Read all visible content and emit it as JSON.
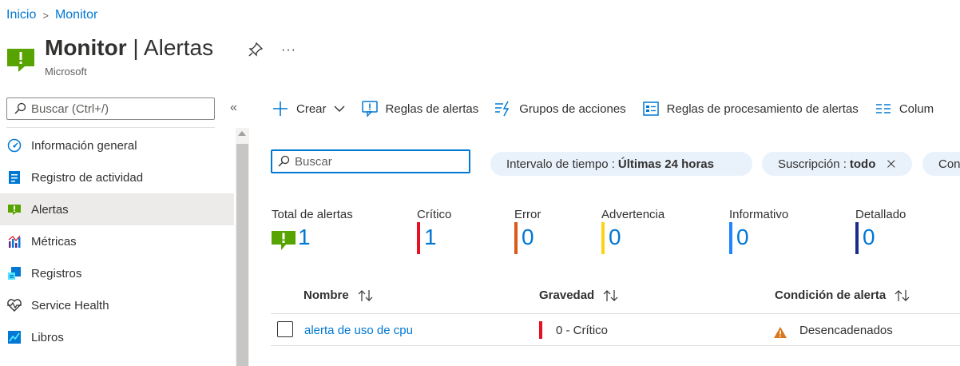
{
  "breadcrumb": {
    "home": "Inicio",
    "current": "Monitor"
  },
  "header": {
    "title_bold": "Monitor",
    "title_rest": " | Alertas",
    "subtitle": "Microsoft",
    "more": "···"
  },
  "sidebar": {
    "search_placeholder": "Buscar (Ctrl+/)",
    "collapse": "«",
    "items": [
      {
        "label": "Información general",
        "icon": "gauge-icon"
      },
      {
        "label": "Registro de actividad",
        "icon": "activity-log-icon"
      },
      {
        "label": "Alertas",
        "icon": "alert-icon",
        "active": true
      },
      {
        "label": "Métricas",
        "icon": "metrics-icon"
      },
      {
        "label": "Registros",
        "icon": "logs-icon"
      },
      {
        "label": "Service Health",
        "icon": "heart-icon"
      },
      {
        "label": "Libros",
        "icon": "workbooks-icon"
      }
    ]
  },
  "toolbar": {
    "create": "Crear",
    "alert_rules": "Reglas de alertas",
    "action_groups": "Grupos de acciones",
    "processing_rules": "Reglas de procesamiento de alertas",
    "columns": "Colum"
  },
  "filters": {
    "search_placeholder": "Buscar",
    "time_label": "Intervalo de tiempo :",
    "time_value": "Últimas 24 horas",
    "subscription_label": "Suscripción :",
    "subscription_value": "todo",
    "more_label": "Con"
  },
  "summary": [
    {
      "label": "Total de alertas",
      "value": "1",
      "color": "#57a300"
    },
    {
      "label": "Crítico",
      "value": "1",
      "color": "#e81123"
    },
    {
      "label": "Error",
      "value": "0",
      "color": "#d9581a"
    },
    {
      "label": "Advertencia",
      "value": "0",
      "color": "#fcd116"
    },
    {
      "label": "Informativo",
      "value": "0",
      "color": "#1f85ff"
    },
    {
      "label": "Detallado",
      "value": "0",
      "color": "#1c2b8a"
    }
  ],
  "table": {
    "columns": [
      "Nombre",
      "Gravedad",
      "Condición de alerta"
    ],
    "rows": [
      {
        "name": "alerta de uso de cpu",
        "severity": "0 - Crítico",
        "severity_color": "#e81123",
        "condition": "Desencadenados"
      }
    ]
  }
}
